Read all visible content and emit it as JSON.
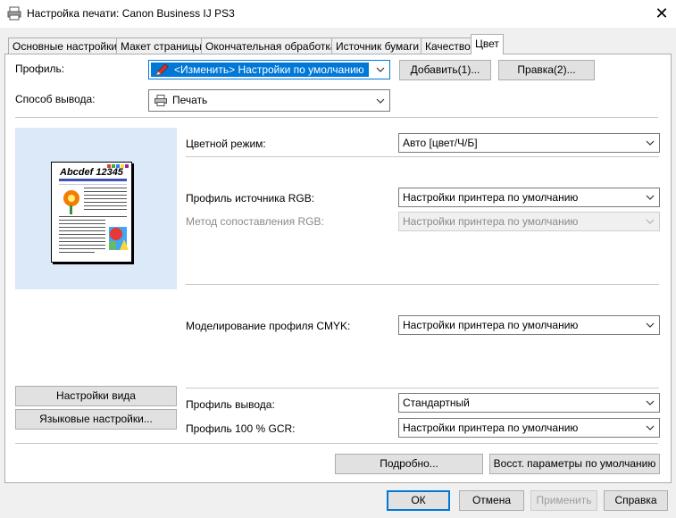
{
  "window": {
    "title": "Настройка печати: Canon Business IJ PS3"
  },
  "tabs": [
    {
      "label": "Основные настройки"
    },
    {
      "label": "Макет страницы"
    },
    {
      "label": "Окончательная обработка"
    },
    {
      "label": "Источник бумаги"
    },
    {
      "label": "Качество"
    },
    {
      "label": "Цвет"
    }
  ],
  "profile": {
    "label": "Профиль:",
    "value": "<Изменить> Настройки по умолчанию",
    "add_button": "Добавить(1)...",
    "edit_button": "Правка(2)..."
  },
  "output_method": {
    "label": "Способ вывода:",
    "value": "Печать"
  },
  "preview": {
    "doc_title": "Abcdef 12345",
    "view_settings_button": "Настройки вида",
    "language_settings_button": "Языковые настройки..."
  },
  "color_mode": {
    "label": "Цветной режим:",
    "value": "Авто [цвет/Ч/Б]"
  },
  "rgb_source_profile": {
    "label": "Профиль источника RGB:",
    "value": "Настройки принтера по умолчанию"
  },
  "rgb_matching_method": {
    "label": "Метод сопоставления RGB:",
    "value": "Настройки принтера по умолчанию"
  },
  "cmyk_simulation": {
    "label": "Моделирование профиля CMYK:",
    "value": "Настройки принтера по умолчанию"
  },
  "output_profile": {
    "label": "Профиль вывода:",
    "value": "Стандартный"
  },
  "gcr_profile": {
    "label": "Профиль 100 % GCR:",
    "value": "Настройки принтера по умолчанию"
  },
  "details_button": "Подробно...",
  "restore_defaults_button": "Восст. параметры по умолчанию",
  "footer": {
    "ok": "ОК",
    "cancel": "Отмена",
    "apply": "Применить",
    "help": "Справка"
  },
  "colors": {
    "selection": "#0078d7",
    "preview_bg": "#dbe9f8"
  }
}
